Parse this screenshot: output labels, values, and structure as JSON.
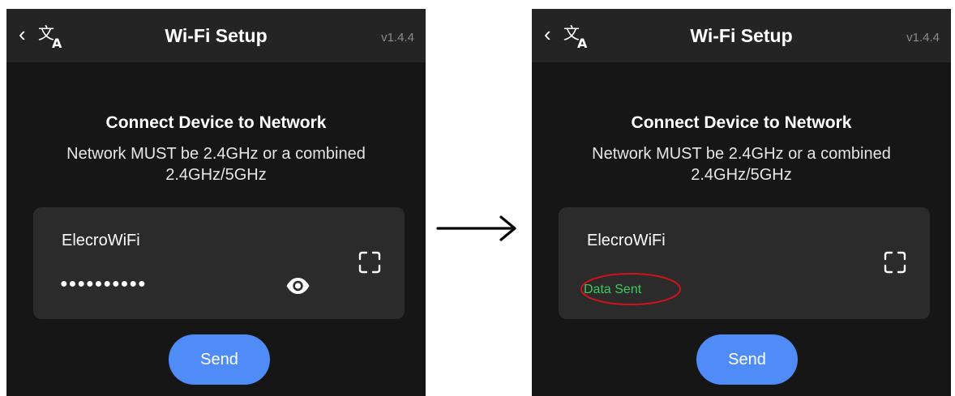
{
  "screens": {
    "before": {
      "header": {
        "back_glyph": "‹",
        "title": "Wi-Fi Setup",
        "version": "v1.4.4",
        "translate_icon": "translate-icon"
      },
      "heading": "Connect Device to Network",
      "subtext": "Network MUST be 2.4GHz or a combined 2.4GHz/5GHz",
      "card": {
        "ssid": "ElecroWiFi",
        "password_masked": "●●●●●●●●●●",
        "reveal_icon": "eye-icon",
        "scan_icon": "scan-icon"
      },
      "send_label": "Send"
    },
    "after": {
      "header": {
        "back_glyph": "‹",
        "title": "Wi-Fi Setup",
        "version": "v1.4.4",
        "translate_icon": "translate-icon"
      },
      "heading": "Connect Device to Network",
      "subtext": "Network MUST be 2.4GHz or a combined 2.4GHz/5GHz",
      "card": {
        "ssid": "ElecroWiFi",
        "status": "Data Sent",
        "scan_icon": "scan-icon"
      },
      "send_label": "Send"
    }
  },
  "transition_icon": "arrow-right-icon",
  "colors": {
    "background": "#161616",
    "header": "#242424",
    "card": "#2b2b2b",
    "accent": "#4f8cf7",
    "status_success": "#3ec85c",
    "highlight": "#d0121b",
    "version_text": "#8c8c8c"
  }
}
